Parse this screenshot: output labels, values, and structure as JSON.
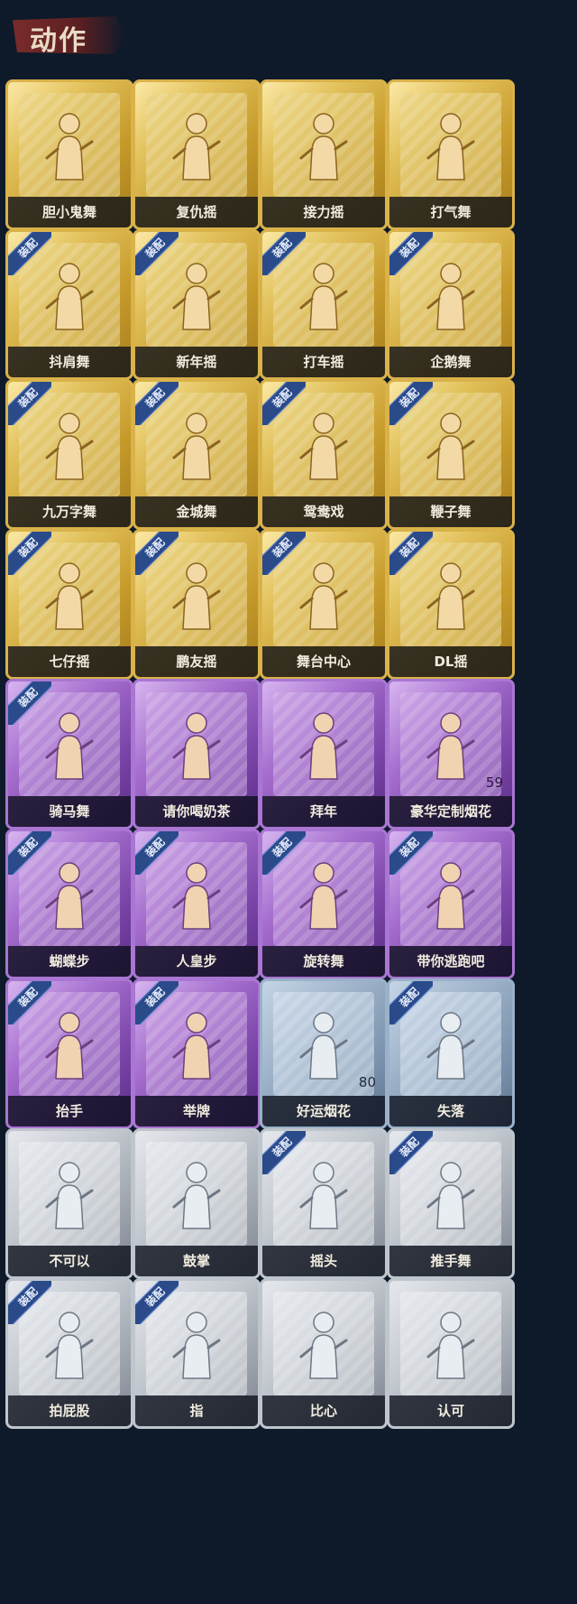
{
  "header": {
    "title": "动作"
  },
  "badge_label": "装配",
  "colors": {
    "background": "#0e1a2a",
    "gold": "#c69a2a",
    "purple": "#7a44a8",
    "gray": "#9aa1aa",
    "steel": "#7890ab",
    "badge": "#2a4a8a"
  },
  "cards": [
    {
      "label": "胆小鬼舞",
      "tier": "gold",
      "equipped": false,
      "count": ""
    },
    {
      "label": "复仇摇",
      "tier": "gold",
      "equipped": false,
      "count": ""
    },
    {
      "label": "接力摇",
      "tier": "gold",
      "equipped": false,
      "count": ""
    },
    {
      "label": "打气舞",
      "tier": "gold",
      "equipped": false,
      "count": ""
    },
    {
      "label": "抖肩舞",
      "tier": "gold",
      "equipped": true,
      "count": ""
    },
    {
      "label": "新年摇",
      "tier": "gold",
      "equipped": true,
      "count": ""
    },
    {
      "label": "打车摇",
      "tier": "gold",
      "equipped": true,
      "count": ""
    },
    {
      "label": "企鹅舞",
      "tier": "gold",
      "equipped": true,
      "count": ""
    },
    {
      "label": "九万字舞",
      "tier": "gold",
      "equipped": true,
      "count": ""
    },
    {
      "label": "金城舞",
      "tier": "gold",
      "equipped": true,
      "count": ""
    },
    {
      "label": "鸳鸯戏",
      "tier": "gold",
      "equipped": true,
      "count": ""
    },
    {
      "label": "鞭子舞",
      "tier": "gold",
      "equipped": true,
      "count": ""
    },
    {
      "label": "七仔摇",
      "tier": "gold",
      "equipped": true,
      "count": ""
    },
    {
      "label": "鹏友摇",
      "tier": "gold",
      "equipped": true,
      "count": ""
    },
    {
      "label": "舞台中心",
      "tier": "gold",
      "equipped": true,
      "count": ""
    },
    {
      "label": "DL摇",
      "tier": "gold",
      "equipped": true,
      "count": ""
    },
    {
      "label": "骑马舞",
      "tier": "purple",
      "equipped": true,
      "count": ""
    },
    {
      "label": "请你喝奶茶",
      "tier": "purple",
      "equipped": false,
      "count": ""
    },
    {
      "label": "拜年",
      "tier": "purple",
      "equipped": false,
      "count": ""
    },
    {
      "label": "豪华定制烟花",
      "tier": "purple",
      "equipped": false,
      "count": "59"
    },
    {
      "label": "蝴蝶步",
      "tier": "purple",
      "equipped": true,
      "count": ""
    },
    {
      "label": "人皇步",
      "tier": "purple",
      "equipped": true,
      "count": ""
    },
    {
      "label": "旋转舞",
      "tier": "purple",
      "equipped": true,
      "count": ""
    },
    {
      "label": "带你逃跑吧",
      "tier": "purple",
      "equipped": true,
      "count": ""
    },
    {
      "label": "抬手",
      "tier": "purple",
      "equipped": true,
      "count": ""
    },
    {
      "label": "举牌",
      "tier": "purple",
      "equipped": true,
      "count": ""
    },
    {
      "label": "好运烟花",
      "tier": "steel",
      "equipped": false,
      "count": "80"
    },
    {
      "label": "失落",
      "tier": "steel",
      "equipped": true,
      "count": ""
    },
    {
      "label": "不可以",
      "tier": "gray",
      "equipped": false,
      "count": ""
    },
    {
      "label": "鼓掌",
      "tier": "gray",
      "equipped": false,
      "count": ""
    },
    {
      "label": "摇头",
      "tier": "gray",
      "equipped": true,
      "count": ""
    },
    {
      "label": "推手舞",
      "tier": "gray",
      "equipped": true,
      "count": ""
    },
    {
      "label": "拍屁股",
      "tier": "gray",
      "equipped": true,
      "count": ""
    },
    {
      "label": "指",
      "tier": "gray",
      "equipped": true,
      "count": ""
    },
    {
      "label": "比心",
      "tier": "gray",
      "equipped": false,
      "count": ""
    },
    {
      "label": "认可",
      "tier": "gray",
      "equipped": false,
      "count": ""
    }
  ]
}
